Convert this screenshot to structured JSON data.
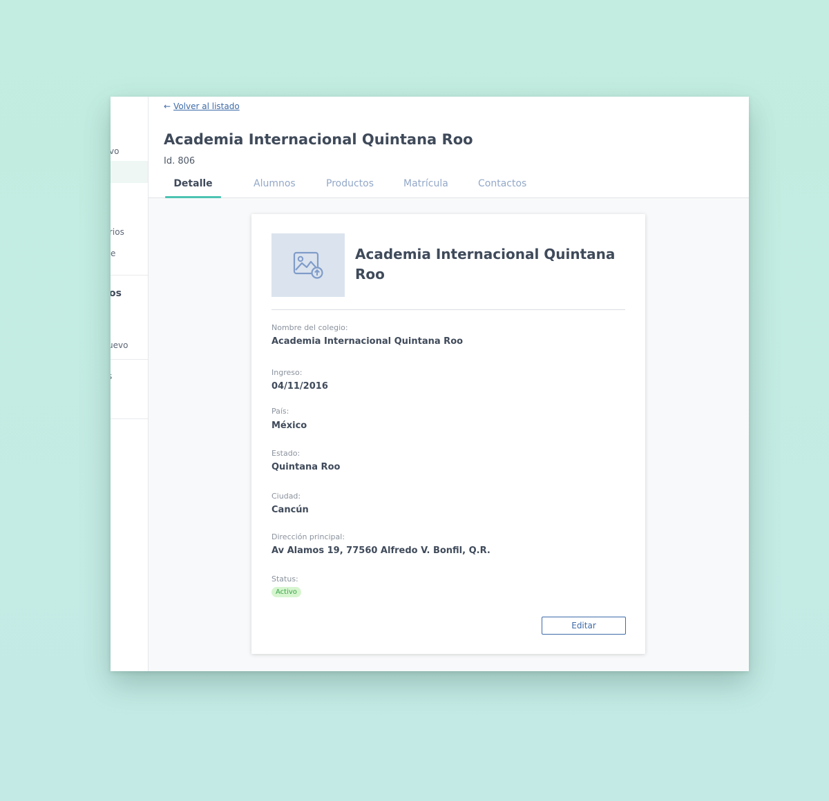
{
  "sidebar": {
    "fragments": [
      "vo",
      "rios",
      "e",
      "os",
      "uevo",
      "s",
      "·",
      "·"
    ]
  },
  "header": {
    "back_arrow": "←",
    "back_label": "Volver al listado",
    "title": "Academia Internacional Quintana Roo",
    "id_label": "Id. 806"
  },
  "tabs": [
    {
      "label": "Detalle",
      "active": true
    },
    {
      "label": "Alumnos",
      "active": false
    },
    {
      "label": "Productos",
      "active": false
    },
    {
      "label": "Matrícula",
      "active": false
    },
    {
      "label": "Contactos",
      "active": false
    }
  ],
  "card": {
    "image_icon": "image-upload-icon",
    "title": "Academia Internacional Quintana Roo",
    "fields": [
      {
        "label": "Nombre del colegio:",
        "value": "Academia Internacional Quintana Roo"
      },
      {
        "label": "Ingreso:",
        "value": "04/11/2016"
      },
      {
        "label": "País:",
        "value": "México"
      },
      {
        "label": "Estado:",
        "value": "Quintana Roo"
      },
      {
        "label": "Ciudad:",
        "value": "Cancún"
      },
      {
        "label": "Dirección principal:",
        "value": "Av Alamos 19, 77560 Alfredo V. Bonfil, Q.R."
      }
    ],
    "status_label": "Status:",
    "status_value": "Activo",
    "edit_label": "Editar"
  },
  "colors": {
    "accent": "#4cc3b2",
    "link": "#3d6aa8",
    "tab_inactive": "#93a8c8",
    "status_bg": "#d6f5cf",
    "status_text": "#3aa44a",
    "background": "#c3ede0"
  }
}
